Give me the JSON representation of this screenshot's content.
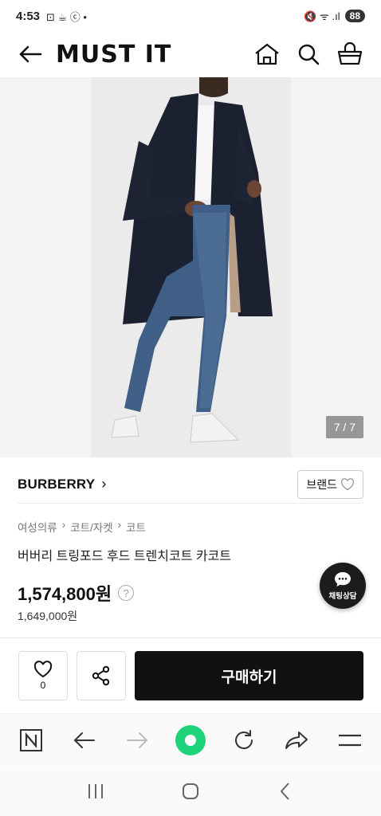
{
  "status_bar": {
    "time": "4:53",
    "mini_icons": "⊡ ☕ ⓒ •",
    "signal_icons": "🔇 ᯤ .ıl",
    "battery": "88"
  },
  "header": {
    "logo": "MUST IT"
  },
  "gallery": {
    "counter": "7 / 7"
  },
  "brand": {
    "name": "BURBERRY",
    "chevron": "›",
    "button_label": "브랜드"
  },
  "breadcrumb": {
    "items": [
      "여성의류",
      "코트/자켓",
      "코트"
    ],
    "separator": "›"
  },
  "product": {
    "title": "버버리 트링포드 후드 트렌치코트 카코트",
    "price": "1,574,800원",
    "help": "?",
    "original_price": "1,649,000원"
  },
  "chat": {
    "label": "채팅상담"
  },
  "actions": {
    "like_count": "0",
    "buy_label": "구매하기"
  },
  "colors": {
    "accent": "#111111",
    "browser_green": "#1fd37a"
  }
}
